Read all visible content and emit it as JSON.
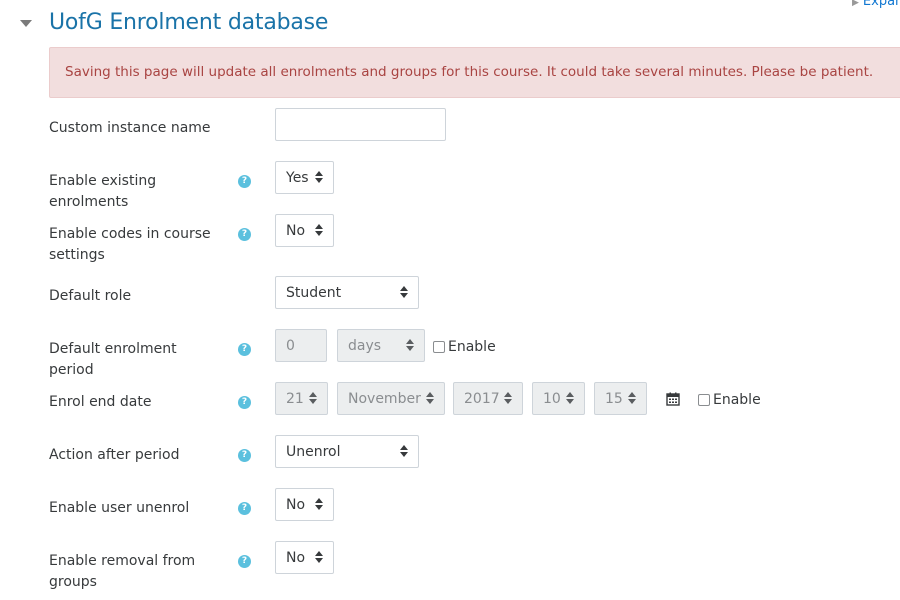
{
  "expand_link": {
    "label": "Expand"
  },
  "section": {
    "title": "UofG Enrolment database"
  },
  "alert": {
    "text": "Saving this page will update all enrolments and groups for this course. It could take several minutes. Please be patient."
  },
  "fields": {
    "custom_instance_name": {
      "label": "Custom instance name",
      "value": ""
    },
    "enable_existing_enrolments": {
      "label": "Enable existing enrolments",
      "value": "Yes"
    },
    "enable_codes": {
      "label": "Enable codes in course settings",
      "value": "No"
    },
    "default_role": {
      "label": "Default role",
      "value": "Student"
    },
    "default_enrolment_period": {
      "label": "Default enrolment period",
      "number": "0",
      "unit": "days",
      "enable_label": "Enable"
    },
    "enrol_end_date": {
      "label": "Enrol end date",
      "day": "21",
      "month": "November",
      "year": "2017",
      "hour": "10",
      "minute": "15",
      "enable_label": "Enable"
    },
    "action_after_period": {
      "label": "Action after period",
      "value": "Unenrol"
    },
    "enable_user_unenrol": {
      "label": "Enable user unenrol",
      "value": "No"
    },
    "enable_removal_from_groups": {
      "label": "Enable removal from groups",
      "value": "No"
    }
  },
  "icons": {
    "help": "question-circle-icon",
    "calendar": "calendar-icon",
    "collapse": "caret-down-icon"
  },
  "colors": {
    "title": "#1a73a8",
    "alert_bg": "#f2dede",
    "alert_text": "#a94442",
    "help_icon": "#5bc0de"
  }
}
